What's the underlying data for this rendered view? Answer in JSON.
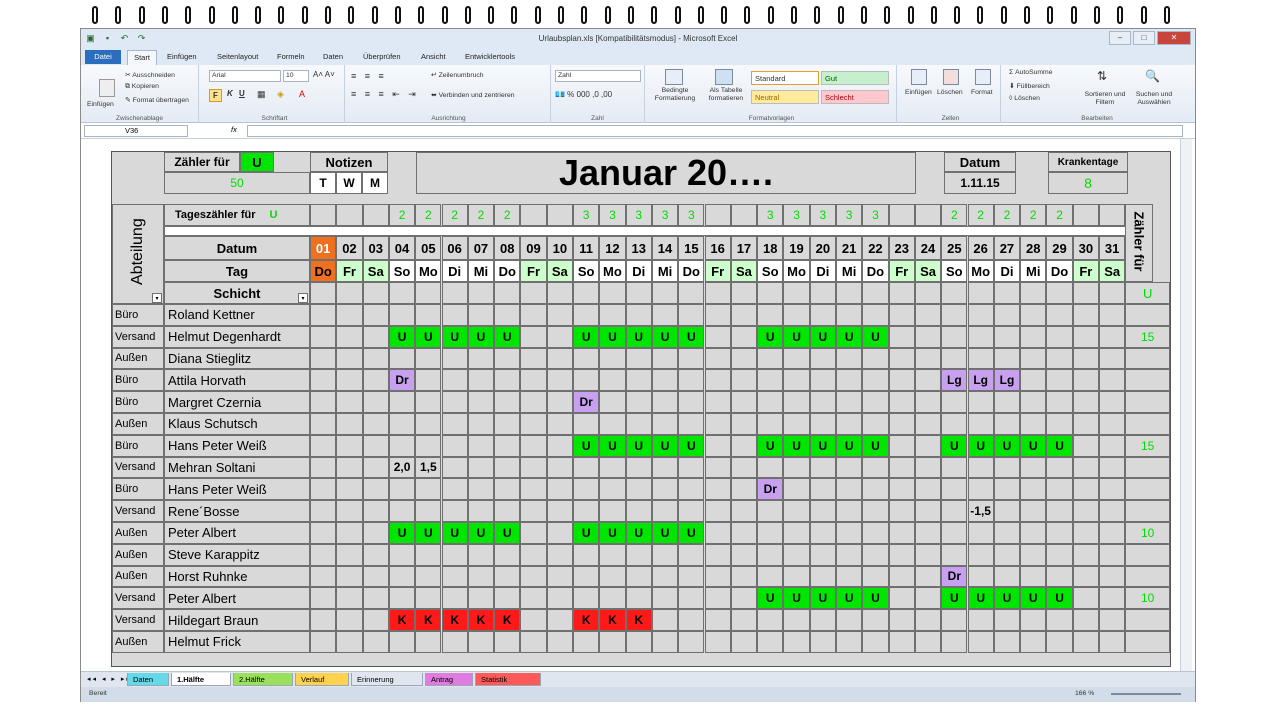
{
  "window": {
    "title": "Urlaubsplan.xls  [Kompatibilitätsmodus] - Microsoft Excel"
  },
  "ribbon_tabs": [
    "Datei",
    "Start",
    "Einfügen",
    "Seitenlayout",
    "Formeln",
    "Daten",
    "Überprüfen",
    "Ansicht",
    "Entwicklertools"
  ],
  "ribbon": {
    "clipboard": {
      "paste": "Einfügen",
      "cut": "Ausschneiden",
      "copy": "Kopieren",
      "format_painter": "Format übertragen",
      "label": "Zwischenablage"
    },
    "font": {
      "name": "Arial",
      "size": "10",
      "bold": "F",
      "italic": "K",
      "underline": "U",
      "label": "Schriftart"
    },
    "alignment": {
      "wrap": "Zeilenumbruch",
      "merge": "Verbinden und zentrieren",
      "label": "Ausrichtung"
    },
    "number": {
      "format": "Zahl",
      "label": "Zahl"
    },
    "styles": {
      "conditional": "Bedingte Formatierung",
      "table": "Als Tabelle formatieren",
      "standard": "Standard",
      "gut": "Gut",
      "neutral": "Neutral",
      "schlecht": "Schlecht",
      "label": "Formatvorlagen"
    },
    "cells": {
      "insert": "Einfügen",
      "delete": "Löschen",
      "format": "Format",
      "label": "Zellen"
    },
    "editing": {
      "autosum": "AutoSumme",
      "fill": "Füllbereich",
      "clear": "Löschen",
      "sort": "Sortieren und Filtern",
      "find": "Suchen und Auswählen",
      "label": "Bearbeiten"
    }
  },
  "formula_bar": {
    "name_box": "V36",
    "fx": "fx",
    "value": ""
  },
  "sheet": {
    "zaehler_label": "Zähler für",
    "zaehler_code": "U",
    "zaehler_value": "50",
    "notizen": "Notizen",
    "notizen_cols": [
      "T",
      "W",
      "M"
    ],
    "title": "Januar 20….",
    "datum_label": "Datum",
    "datum_value": "1.11.15",
    "krank_label": "Krankentage",
    "krank_value": "8",
    "tageszaehler_label": "Tageszähler für",
    "tageszaehler_code": "U",
    "abteilung": "Abteilung",
    "datum_row": "Datum",
    "tag_row": "Tag",
    "schicht_row": "Schicht",
    "right_header": "Zähler für",
    "right_code": "U",
    "days": [
      "01",
      "02",
      "03",
      "04",
      "05",
      "06",
      "07",
      "08",
      "09",
      "10",
      "11",
      "12",
      "13",
      "14",
      "15",
      "16",
      "17",
      "18",
      "19",
      "20",
      "21",
      "22",
      "23",
      "24",
      "25",
      "26",
      "27",
      "28",
      "29",
      "30",
      "31"
    ],
    "weekdays": [
      "Do",
      "Fr",
      "Sa",
      "So",
      "Mo",
      "Di",
      "Mi",
      "Do",
      "Fr",
      "Sa",
      "So",
      "Mo",
      "Di",
      "Mi",
      "Do",
      "Fr",
      "Sa",
      "So",
      "Mo",
      "Di",
      "Mi",
      "Do",
      "Fr",
      "Sa",
      "So",
      "Mo",
      "Di",
      "Mi",
      "Do",
      "Fr",
      "Sa"
    ],
    "day_counts": [
      "",
      "",
      "",
      "2",
      "2",
      "2",
      "2",
      "2",
      "",
      "",
      "3",
      "3",
      "3",
      "3",
      "3",
      "",
      "",
      "3",
      "3",
      "3",
      "3",
      "3",
      "",
      "",
      "2",
      "2",
      "2",
      "2",
      "2",
      "",
      ""
    ],
    "rows": [
      {
        "dept": "Büro",
        "name": "Roland Kettner",
        "cells": {},
        "count": ""
      },
      {
        "dept": "Versand",
        "name": "Helmut Degenhardt",
        "cells": {
          "4": "U",
          "5": "U",
          "6": "U",
          "7": "U",
          "8": "U",
          "11": "U",
          "12": "U",
          "13": "U",
          "14": "U",
          "15": "U",
          "18": "U",
          "19": "U",
          "20": "U",
          "21": "U",
          "22": "U"
        },
        "count": "15"
      },
      {
        "dept": "Außen",
        "name": "Diana Stieglitz",
        "cells": {},
        "count": ""
      },
      {
        "dept": "Büro",
        "name": "Attila Horvath",
        "cells": {
          "4": "Dr",
          "25": "Lg",
          "26": "Lg",
          "27": "Lg"
        },
        "count": ""
      },
      {
        "dept": "Büro",
        "name": "Margret Czernia",
        "cells": {
          "11": "Dr"
        },
        "count": ""
      },
      {
        "dept": "Außen",
        "name": "Klaus Schutsch",
        "cells": {},
        "count": ""
      },
      {
        "dept": "Büro",
        "name": "Hans Peter Weiß",
        "cells": {
          "11": "U",
          "12": "U",
          "13": "U",
          "14": "U",
          "15": "U",
          "18": "U",
          "19": "U",
          "20": "U",
          "21": "U",
          "22": "U",
          "25": "U",
          "26": "U",
          "27": "U",
          "28": "U",
          "29": "U"
        },
        "count": "15"
      },
      {
        "dept": "Versand",
        "name": "Mehran Soltani",
        "cells": {
          "4": "2,0",
          "5": "1,5"
        },
        "count": ""
      },
      {
        "dept": "Büro",
        "name": "Hans Peter Weiß",
        "cells": {
          "18": "Dr"
        },
        "count": ""
      },
      {
        "dept": "Versand",
        "name": "Rene´Bosse",
        "cells": {
          "26": "-1,5"
        },
        "count": ""
      },
      {
        "dept": "Außen",
        "name": "Peter Albert",
        "cells": {
          "4": "U",
          "5": "U",
          "6": "U",
          "7": "U",
          "8": "U",
          "11": "U",
          "12": "U",
          "13": "U",
          "14": "U",
          "15": "U"
        },
        "count": "10"
      },
      {
        "dept": "Außen",
        "name": "Steve Karappitz",
        "cells": {},
        "count": ""
      },
      {
        "dept": "Außen",
        "name": "Horst Ruhnke",
        "cells": {
          "25": "Dr"
        },
        "count": ""
      },
      {
        "dept": "Versand",
        "name": "Peter Albert",
        "cells": {
          "18": "U",
          "19": "U",
          "20": "U",
          "21": "U",
          "22": "U",
          "25": "U",
          "26": "U",
          "27": "U",
          "28": "U",
          "29": "U"
        },
        "count": "10"
      },
      {
        "dept": "Versand",
        "name": "Hildegart Braun",
        "cells": {
          "4": "K",
          "5": "K",
          "6": "K",
          "7": "K",
          "8": "K",
          "11": "K",
          "12": "K",
          "13": "K"
        },
        "count": ""
      },
      {
        "dept": "Außen",
        "name": "Helmut Frick",
        "cells": {},
        "count": ""
      }
    ]
  },
  "sheet_tabs": [
    {
      "label": "Daten",
      "color": "#66d9e8"
    },
    {
      "label": "1.Hälfte",
      "color": "#ffffff"
    },
    {
      "label": "2.Hälfte",
      "color": "#9be05b"
    },
    {
      "label": "Verlauf",
      "color": "#ffd24d"
    },
    {
      "label": "Erinnerung",
      "color": "#dfe6ef"
    },
    {
      "label": "Antrag",
      "color": "#e07be0"
    },
    {
      "label": "Statistik",
      "color": "#ff5a5a"
    }
  ],
  "status": {
    "ready": "Bereit",
    "zoom": "166 %"
  },
  "colors": {
    "green": "#00e600",
    "red": "#ff1a1a",
    "purple": "#c8a0f0",
    "orange": "#f07020",
    "weekend": "#ccffcc",
    "count": "#00dd00"
  }
}
